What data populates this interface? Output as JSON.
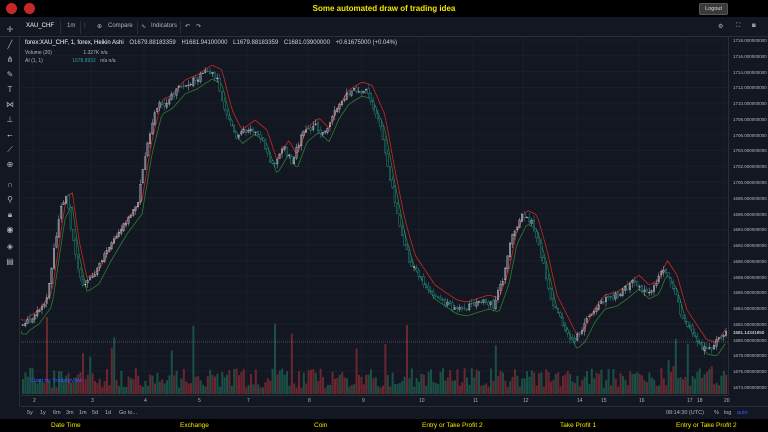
{
  "header": {
    "title": "Some automated draw of trading idea",
    "logout_label": "Logout"
  },
  "toolbar": {
    "symbol": "XAU_CHF",
    "interval": "1m",
    "compare_label": "Compare",
    "indicators_label": "Indicators"
  },
  "legend": {
    "symbol": "forex:XAU_CHF, 1, forex, Heikin Ashi",
    "open": "O1679.88183359",
    "high": "H1681.94100000",
    "low": "L1679.88183359",
    "close": "C1681.03900000",
    "change": "+0.61675000 (+0.04%)",
    "volume": "Volume (20)",
    "volume_val": "1.327K  n/a",
    "ai": "AI (1, 1)",
    "ai_val": "1678.8932",
    "ai_na": "n/a  n/a"
  },
  "watermark": "Chart by TradingView",
  "price_axis": {
    "labels": [
      "1718.000000000",
      "1716.000000000",
      "1714.000000000",
      "1712.000000000",
      "1710.000000000",
      "1708.000000000",
      "1706.000000000",
      "1704.000000000",
      "1702.000000000",
      "1700.000000000",
      "1698.000000000",
      "1696.000000000",
      "1694.000000000",
      "1692.000000000",
      "1690.000000000",
      "1688.000000000",
      "1686.000000000",
      "1684.000000000",
      "1682.000000000",
      "1680.000000000",
      "1678.000000000",
      "1676.000000000",
      "1674.000000000"
    ],
    "current": "1681.14341950"
  },
  "time_axis": {
    "labels": [
      "2",
      "3",
      "4",
      "5",
      "7",
      "8",
      "9",
      "10",
      "11",
      "12",
      "14",
      "15",
      "16",
      "17",
      "18",
      "20"
    ]
  },
  "bottom": {
    "ranges": [
      "5y",
      "1y",
      "6m",
      "3m",
      "1m",
      "5d",
      "1d",
      "Go to..."
    ],
    "time": "08:14:30 (UTC)",
    "pct": "%",
    "log": "log",
    "auto": "auto"
  },
  "footer": {
    "items": [
      "Date Time",
      "Exchange",
      "Coin",
      "Entry or Take Profit 2",
      "Take Profit 1",
      "Entry or Take Profit 2"
    ]
  },
  "colors": {
    "up": "#d1d4dc",
    "down": "#26a69a",
    "ma_red": "#c62828",
    "ma_green": "#2e7d32",
    "accent": "#f5e800"
  }
}
